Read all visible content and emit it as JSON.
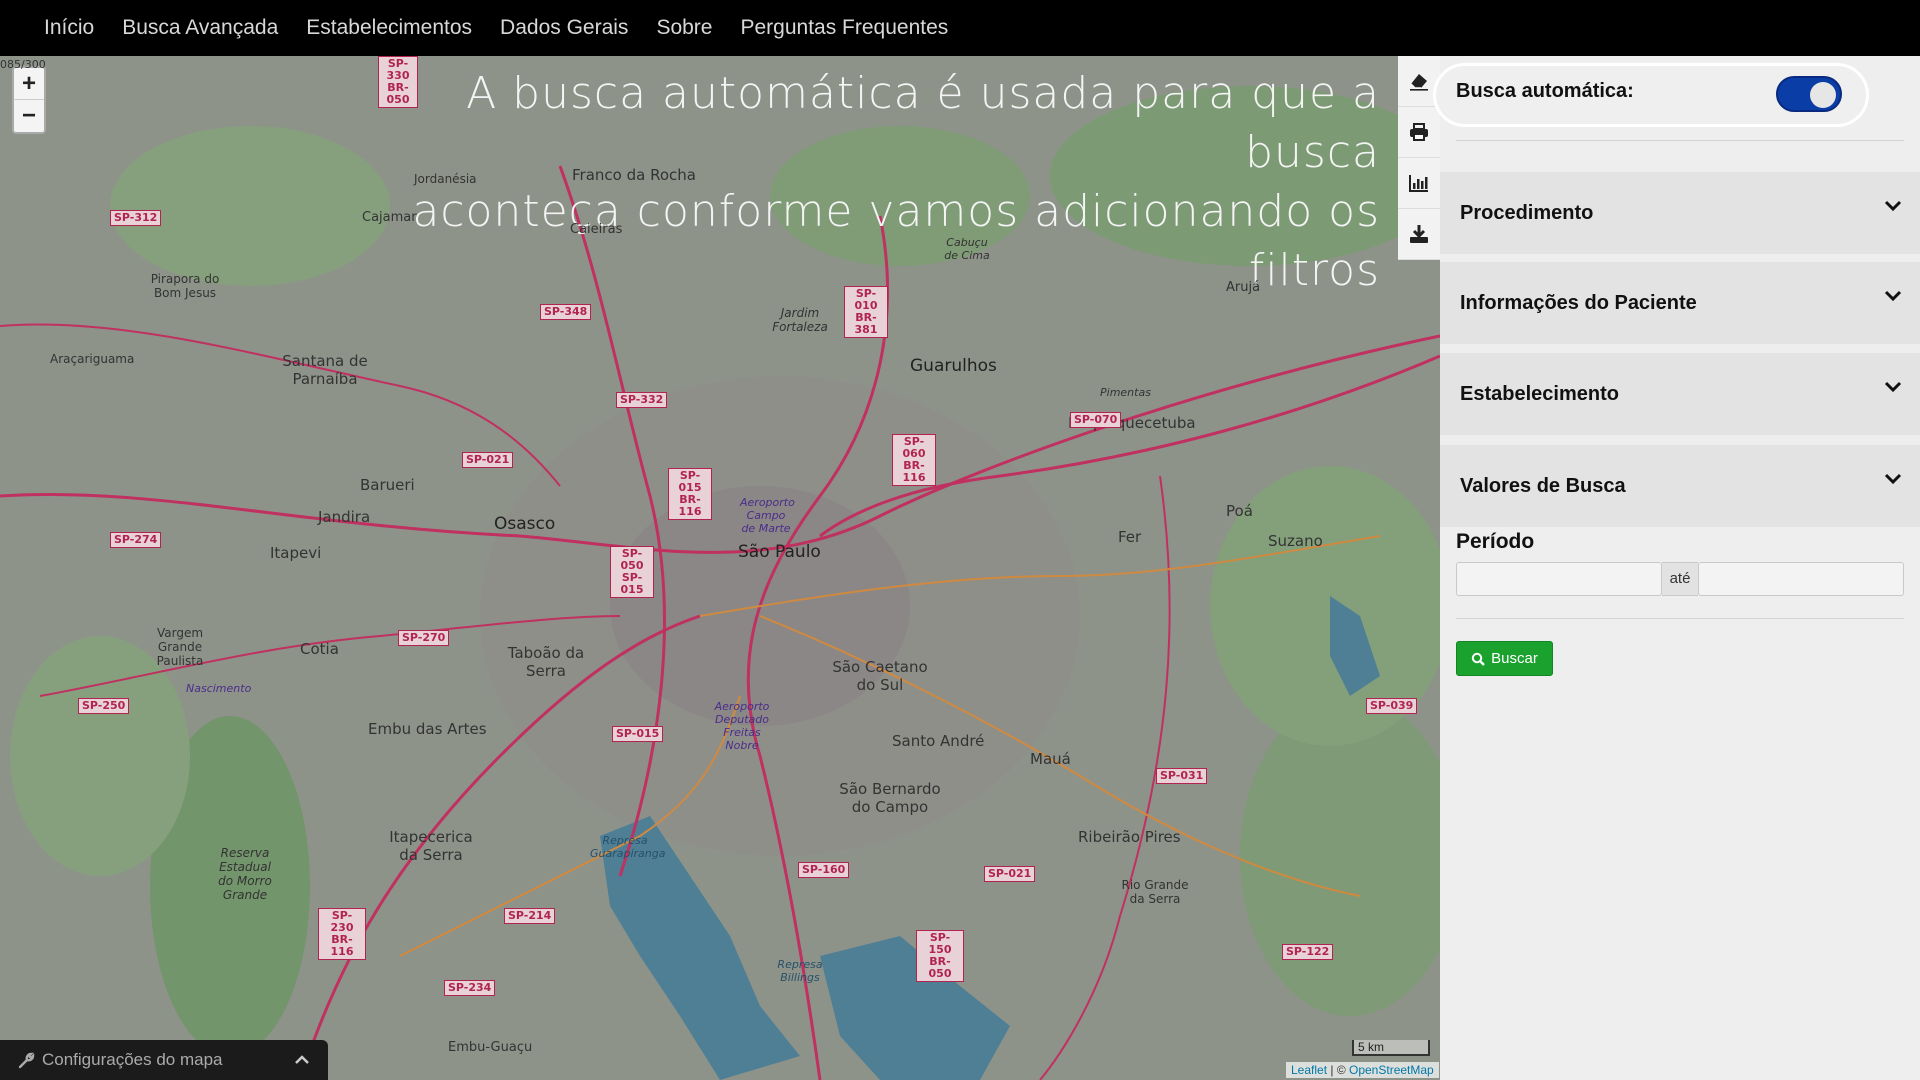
{
  "nav": {
    "items": [
      "Início",
      "Busca Avançada",
      "Estabelecimentos",
      "Dados Gerais",
      "Sobre",
      "Perguntas Frequentes"
    ]
  },
  "map": {
    "overlay_line1": "A busca automática é usada para que a busca",
    "overlay_line2": "aconteça conforme vamos adicionando os filtros",
    "zoom_in": "+",
    "zoom_out": "−",
    "scale": "5 km",
    "attribution_leaflet": "Leaflet",
    "attribution_sep": " | © ",
    "attribution_osm": "OpenStreetMap",
    "config_label": "Configurações do mapa",
    "tools": [
      "eraser-icon",
      "print-icon",
      "chart-icon",
      "download-icon"
    ],
    "corner_label": "085/300",
    "places": [
      "Franco da Rocha",
      "Caieiras",
      "Cajamar",
      "Jordanésia",
      "Pirapora do Bom Jesus",
      "Santana de Parnaíba",
      "Araçariguama",
      "Barueri",
      "Jandira",
      "Osasco",
      "Itapevi",
      "São Paulo",
      "Guarulhos",
      "Itaquaquecetuba",
      "Arujá",
      "Poá",
      "Suzano",
      "Fer",
      "Cotia",
      "Vargem Grande Paulista",
      "Taboão da Serra",
      "Embu das Artes",
      "São Caetano do Sul",
      "Santo André",
      "Mauá",
      "São Bernardo do Campo",
      "Ribeirão Pires",
      "Rio Grande da Serra",
      "Itapecerica da Serra",
      "Reserva Estadual do Morro Grande",
      "Embu-Guaçu",
      "Jardim Fortaleza",
      "Cabuçu de Cima",
      "Pimentas",
      "Nascimento",
      "Aeroporto Campo de Marte",
      "Aeroporto Deputado Freitas Nobre",
      "Represa Guarapiranga",
      "Represa Billings"
    ],
    "roads": [
      "SP-330 BR-050",
      "SP-312",
      "SP-348",
      "SP-332",
      "SP-010 BR-381",
      "SP-021",
      "SP-015 BR-116",
      "SP-274",
      "SP-050 SP-015",
      "SP-270",
      "SP-250",
      "SP-015",
      "SP-060 BR-116",
      "SP-070",
      "SP-039",
      "SP-031",
      "SP-160",
      "SP-021",
      "SP-214",
      "SP-230 BR-116",
      "SP-234",
      "SP-150 BR-050",
      "SP-122"
    ]
  },
  "panel": {
    "auto_search_label": "Busca automática:",
    "auto_search_on": true,
    "sections": [
      "Procedimento",
      "Informações do Paciente",
      "Estabelecimento",
      "Valores de Busca"
    ],
    "periodo_label": "Período",
    "date_sep": "até",
    "date_from": "",
    "date_to": "",
    "search_button": "Buscar"
  },
  "colors": {
    "navbar": "#000000",
    "toggle_on": "#0a3ea6",
    "search_button": "#1aa12e",
    "road": "#b12450"
  }
}
